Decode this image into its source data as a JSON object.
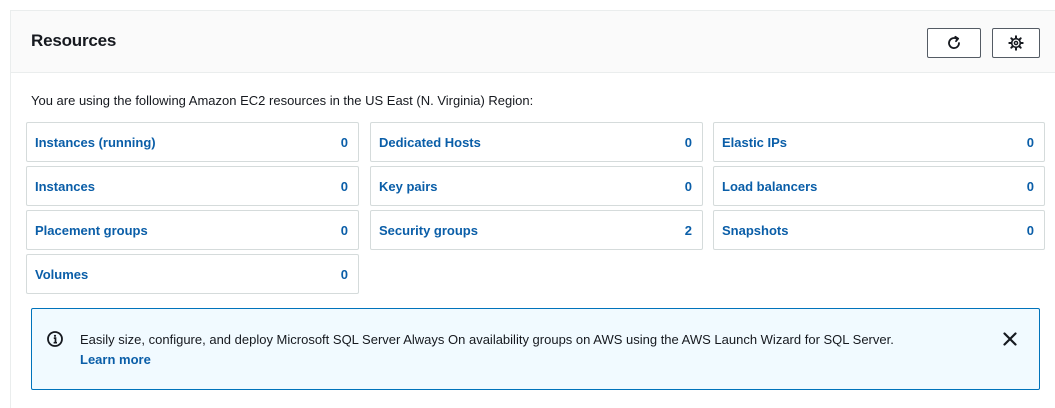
{
  "header": {
    "title": "Resources",
    "refresh_icon": "refresh-icon",
    "settings_icon": "gear-icon"
  },
  "intro_text": "You are using the following Amazon EC2 resources in the US East (N. Virginia) Region:",
  "resources": [
    {
      "label": "Instances (running)",
      "count": "0"
    },
    {
      "label": "Dedicated Hosts",
      "count": "0"
    },
    {
      "label": "Elastic IPs",
      "count": "0"
    },
    {
      "label": "Instances",
      "count": "0"
    },
    {
      "label": "Key pairs",
      "count": "0"
    },
    {
      "label": "Load balancers",
      "count": "0"
    },
    {
      "label": "Placement groups",
      "count": "0"
    },
    {
      "label": "Security groups",
      "count": "2"
    },
    {
      "label": "Snapshots",
      "count": "0"
    },
    {
      "label": "Volumes",
      "count": "0"
    }
  ],
  "info_banner": {
    "text": "Easily size, configure, and deploy Microsoft SQL Server Always On availability groups on AWS using the AWS Launch Wizard for SQL Server.",
    "link": "Learn more",
    "icon": "info-icon",
    "close_icon": "close-icon"
  },
  "colors": {
    "link": "#0a5ea8",
    "info_border": "#0073bb",
    "info_background": "#f1faff",
    "card_border": "#d5dbdb"
  }
}
